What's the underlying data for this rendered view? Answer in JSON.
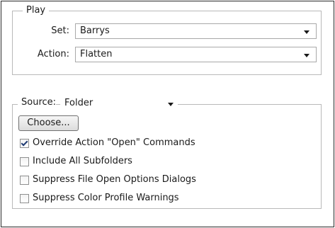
{
  "play": {
    "legend": "Play",
    "set_label": "Set:",
    "set_value": "Barrys",
    "action_label": "Action:",
    "action_value": "Flatten"
  },
  "source": {
    "label": "Source:",
    "value": "Folder",
    "choose_label": "Choose...",
    "options": [
      {
        "label": "Override Action \"Open\" Commands",
        "checked": true
      },
      {
        "label": "Include All Subfolders",
        "checked": false
      },
      {
        "label": "Suppress File Open Options Dialogs",
        "checked": false
      },
      {
        "label": "Suppress Color Profile Warnings",
        "checked": false
      }
    ]
  },
  "icons": {
    "dropdown": "chevron-down-icon",
    "check": "checkmark-icon"
  }
}
